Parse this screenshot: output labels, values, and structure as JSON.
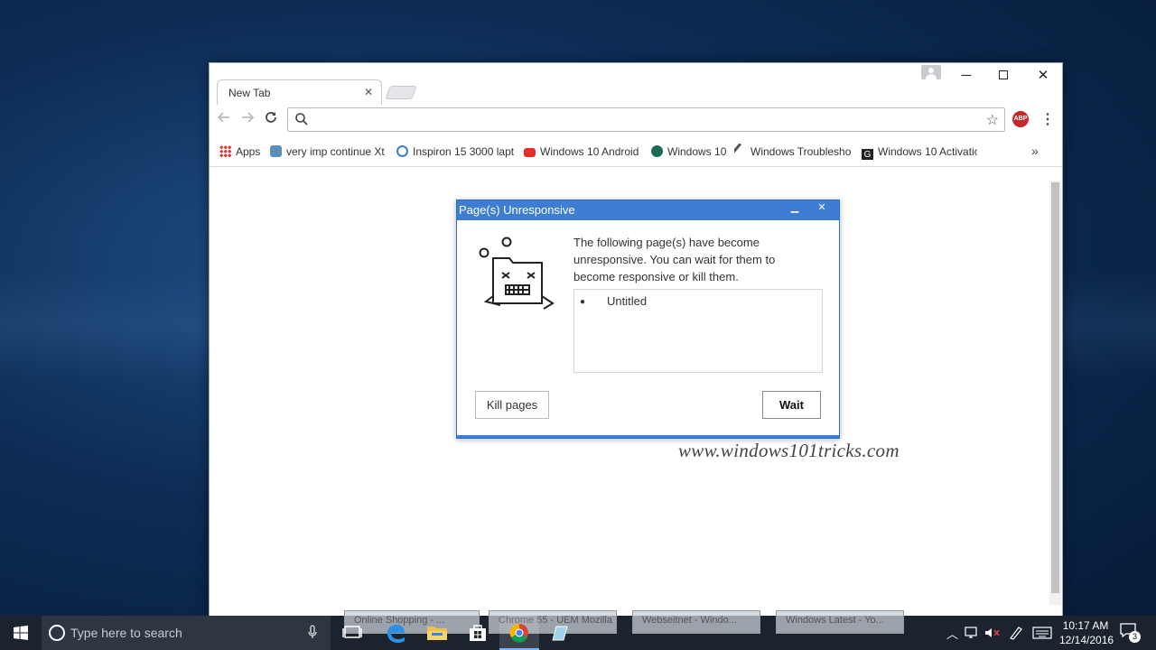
{
  "browser": {
    "tab_title": "New Tab",
    "tab_close": "✕",
    "window_controls": {
      "minimize": "─",
      "close": "✕"
    },
    "omnibox_value": "",
    "extension": "ABP",
    "bookmarks": [
      {
        "label": "Apps",
        "icon": "apps-grid-icon"
      },
      {
        "label": "very imp  continue Xt",
        "icon": "box-icon",
        "color": "#5b8fb9"
      },
      {
        "label": "Inspiron 15 3000 lapt",
        "icon": "dell-icon",
        "color": "#3b7fc4"
      },
      {
        "label": "Windows 10 Android",
        "icon": "youtube-icon",
        "color": "#e52d27"
      },
      {
        "label": "Windows 10",
        "icon": "windows-circle-icon",
        "color": "#1a6b55"
      },
      {
        "label": "Windows Troubleshoo",
        "icon": "hammer-icon",
        "color": "#555555"
      },
      {
        "label": "Windows 10 Activatio",
        "icon": "g-icon",
        "color": "#222222"
      }
    ],
    "bookmarks_more": "»"
  },
  "dialog": {
    "title": "Page(s) Unresponsive",
    "minimize": "▁",
    "close": "✕",
    "message": "The following page(s) have become unresponsive. You can wait for them to become responsive or kill them.",
    "pages": [
      "Untitled"
    ],
    "kill_button": "Kill pages",
    "wait_button": "Wait"
  },
  "watermark": "www.windows101tricks.com",
  "taskbar": {
    "search_placeholder": "Type here to search",
    "ghost_windows": [
      "Online Shopping - ...",
      "Chrome 55 - UEM Mozilla",
      "Webseitnet - Windo...",
      "Windows Latest - Yo..."
    ],
    "clock_time": "10:17 AM",
    "clock_date": "12/14/2016",
    "notification_count": "3"
  },
  "colors": {
    "dialog_title_bar": "#3e7ed2",
    "taskbar": "#1b232e",
    "desktop": "#0d2c55"
  }
}
